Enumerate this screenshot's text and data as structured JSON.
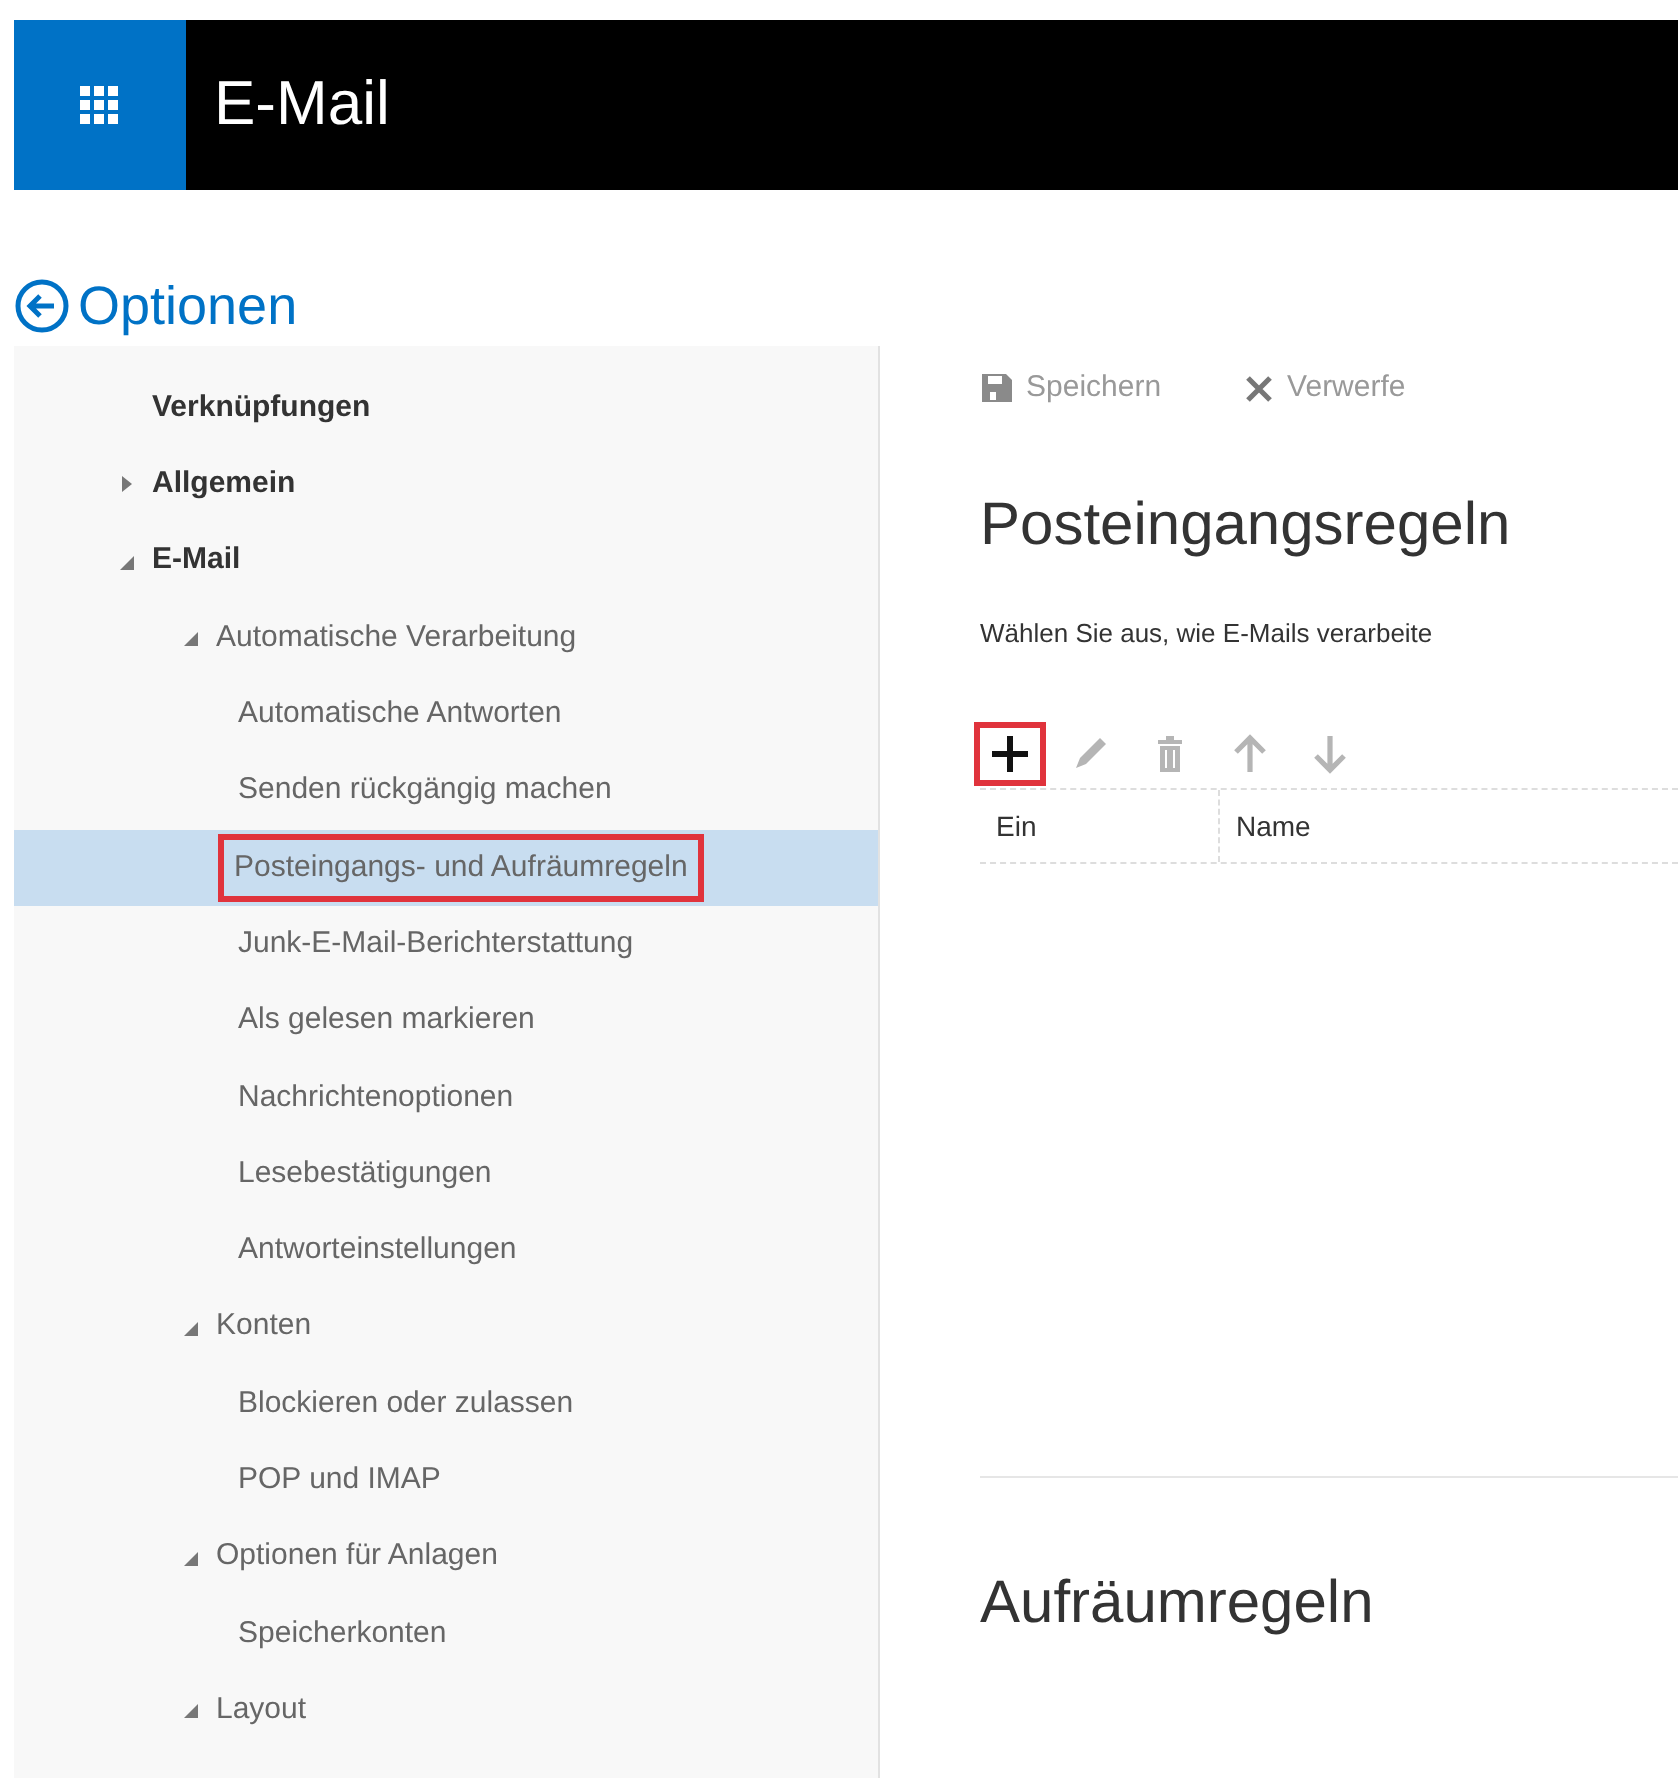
{
  "app_bar": {
    "title": "E-Mail"
  },
  "back": {
    "label": "Optionen"
  },
  "sidebar": {
    "items": [
      {
        "label": "Verknüpfungen",
        "selected": false
      },
      {
        "label": "Allgemein",
        "expanded": false,
        "selected": false
      },
      {
        "label": "E-Mail",
        "expanded": true,
        "selected": false,
        "children": [
          {
            "label": "Automatische Verarbeitung",
            "expanded": true,
            "selected": false,
            "children": [
              {
                "label": "Automatische Antworten",
                "selected": false
              },
              {
                "label": "Senden rückgängig machen",
                "selected": false
              },
              {
                "label": "Posteingangs- und Aufräumregeln",
                "selected": true,
                "annotated": true
              },
              {
                "label": "Junk-E-Mail-Berichterstattung",
                "selected": false
              },
              {
                "label": "Als gelesen markieren",
                "selected": false
              },
              {
                "label": "Nachrichtenoptionen",
                "selected": false
              },
              {
                "label": "Lesebestätigungen",
                "selected": false
              },
              {
                "label": "Antworteinstellungen",
                "selected": false
              }
            ]
          },
          {
            "label": "Konten",
            "expanded": true,
            "selected": false,
            "children": [
              {
                "label": "Blockieren oder zulassen",
                "selected": false
              },
              {
                "label": "POP und IMAP",
                "selected": false
              }
            ]
          },
          {
            "label": "Optionen für Anlagen",
            "expanded": true,
            "selected": false,
            "children": [
              {
                "label": "Speicherkonten",
                "selected": false
              }
            ]
          },
          {
            "label": "Layout",
            "expanded": true,
            "selected": false
          }
        ]
      }
    ]
  },
  "command_bar": [
    {
      "kind": "save",
      "label": "Speichern",
      "disabled": true
    },
    {
      "kind": "discard",
      "label": "Verwerfe",
      "disabled": true
    }
  ],
  "heading": "Posteingangsregeln",
  "description": "Wählen Sie aus, wie E-Mails verarbeite",
  "rule_tools": [
    {
      "kind": "add",
      "disabled": false,
      "annotated": true
    },
    {
      "kind": "edit",
      "disabled": true,
      "annotated": false
    },
    {
      "kind": "delete",
      "disabled": true,
      "annotated": false
    },
    {
      "kind": "up",
      "disabled": true,
      "annotated": false
    },
    {
      "kind": "down",
      "disabled": true,
      "annotated": false
    }
  ],
  "table": {
    "columns": [
      "Ein",
      "Name"
    ]
  },
  "second_heading": "Aufräumregeln"
}
